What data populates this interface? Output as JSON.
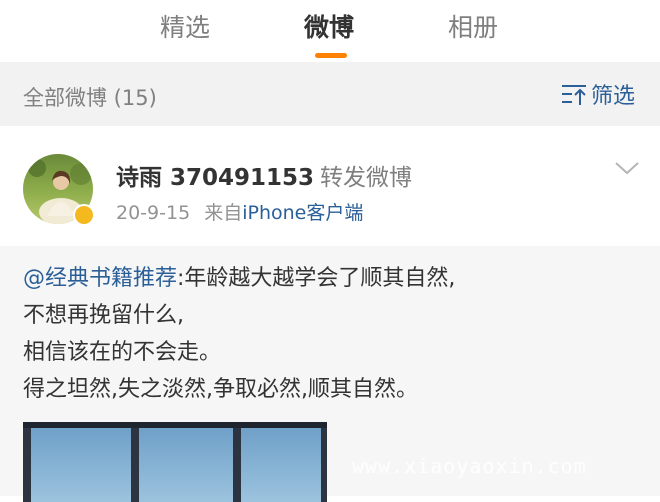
{
  "tabs": [
    {
      "label": "精选",
      "active": false
    },
    {
      "label": "微博",
      "active": true
    },
    {
      "label": "相册",
      "active": false
    }
  ],
  "accent_color": "#ff8200",
  "link_color": "#2b5f98",
  "filter_bar": {
    "count_label": "全部微博 (15)",
    "filter_label": "筛选",
    "filter_icon": "sort-filter-icon"
  },
  "post": {
    "username": "诗雨 370491153",
    "action": "转发微博",
    "date": "20-9-15",
    "source_prefix": "来自",
    "source": "iPhone客户端",
    "avatar_badge": "verified-badge-icon",
    "menu_icon": "chevron-down-icon"
  },
  "repost": {
    "mention": "@经典书籍推荐",
    "text_first_line": ":年龄越大越学会了顺其自然,",
    "lines": [
      "不想再挽留什么,",
      "相信该在的不会走。",
      "得之坦然,失之淡然,争取必然,顺其自然。"
    ]
  },
  "watermark": "www.xiaoyaoxin.com"
}
